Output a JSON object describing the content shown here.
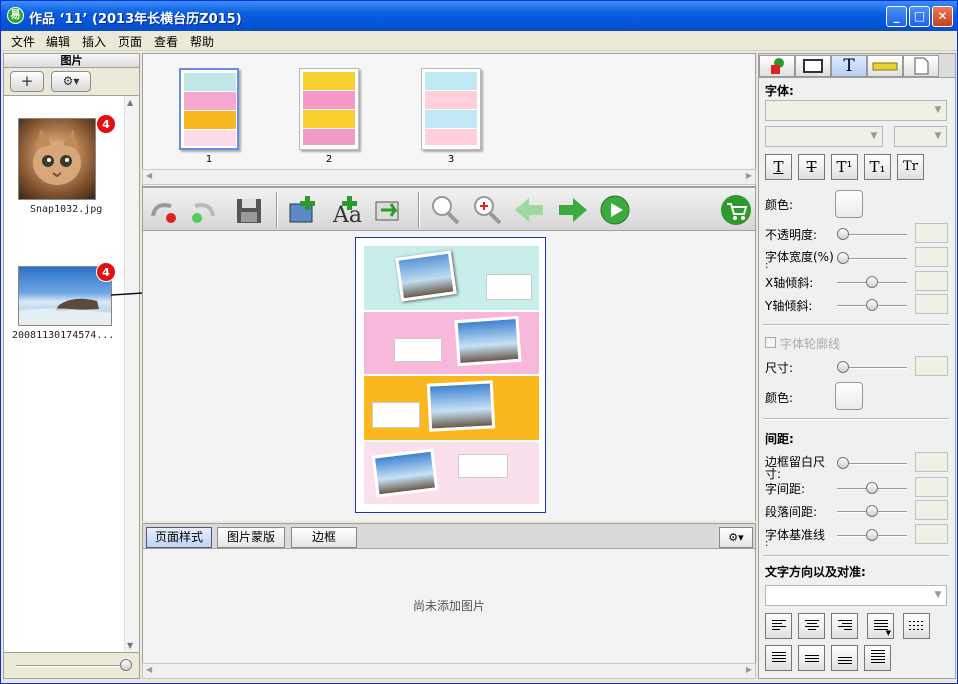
{
  "window": {
    "title": "作品 ‘11’ (2013年长横台历Z015)",
    "min": "_",
    "max": "□",
    "close": "✕"
  },
  "menu": [
    "文件",
    "编辑",
    "插入",
    "页面",
    "查看",
    "帮助"
  ],
  "left": {
    "header": "图片",
    "add": "+",
    "gear": "⚙▾",
    "images": [
      {
        "name": "Snap1032.jpg",
        "count": "4"
      },
      {
        "name": "20081130174574...",
        "count": "4"
      }
    ]
  },
  "pages": [
    "1",
    "2",
    "3"
  ],
  "tabs": [
    "页面样式",
    "图片蒙版",
    "边框"
  ],
  "style_area": {
    "empty": "尚未添加图片",
    "gear": "⚙▾"
  },
  "right": {
    "tabs_icons": [
      "shape-icon",
      "frame-icon",
      "text-icon",
      "ruler-icon",
      "page-icon"
    ],
    "text_tab_glyph": "T",
    "font_label": "字体:",
    "style_buttons": [
      "T",
      "T",
      "T¹",
      "T₁",
      "Tr"
    ],
    "color_label": "颜色:",
    "opacity_label": "不透明度:",
    "width_label": "字体宽度(%)",
    "width_colon": ":",
    "xskew_label": "X轴倾斜:",
    "yskew_label": "Y轴倾斜:",
    "outline_label": "字体轮廓线",
    "size_label": "尺寸:",
    "color2_label": "颜色:",
    "spacing_header": "间距:",
    "margin_label": "边框留白尺",
    "margin_label2": "寸:",
    "char_spacing": "字间距:",
    "para_spacing": "段落间距:",
    "baseline_label": "字体基准线",
    "baseline_colon": ":",
    "direction_header": "文字方向以及对准:"
  },
  "colors": {
    "titlebar": "#0A5FE0",
    "accent": "#3DAA3D",
    "badge": "#E01010"
  }
}
